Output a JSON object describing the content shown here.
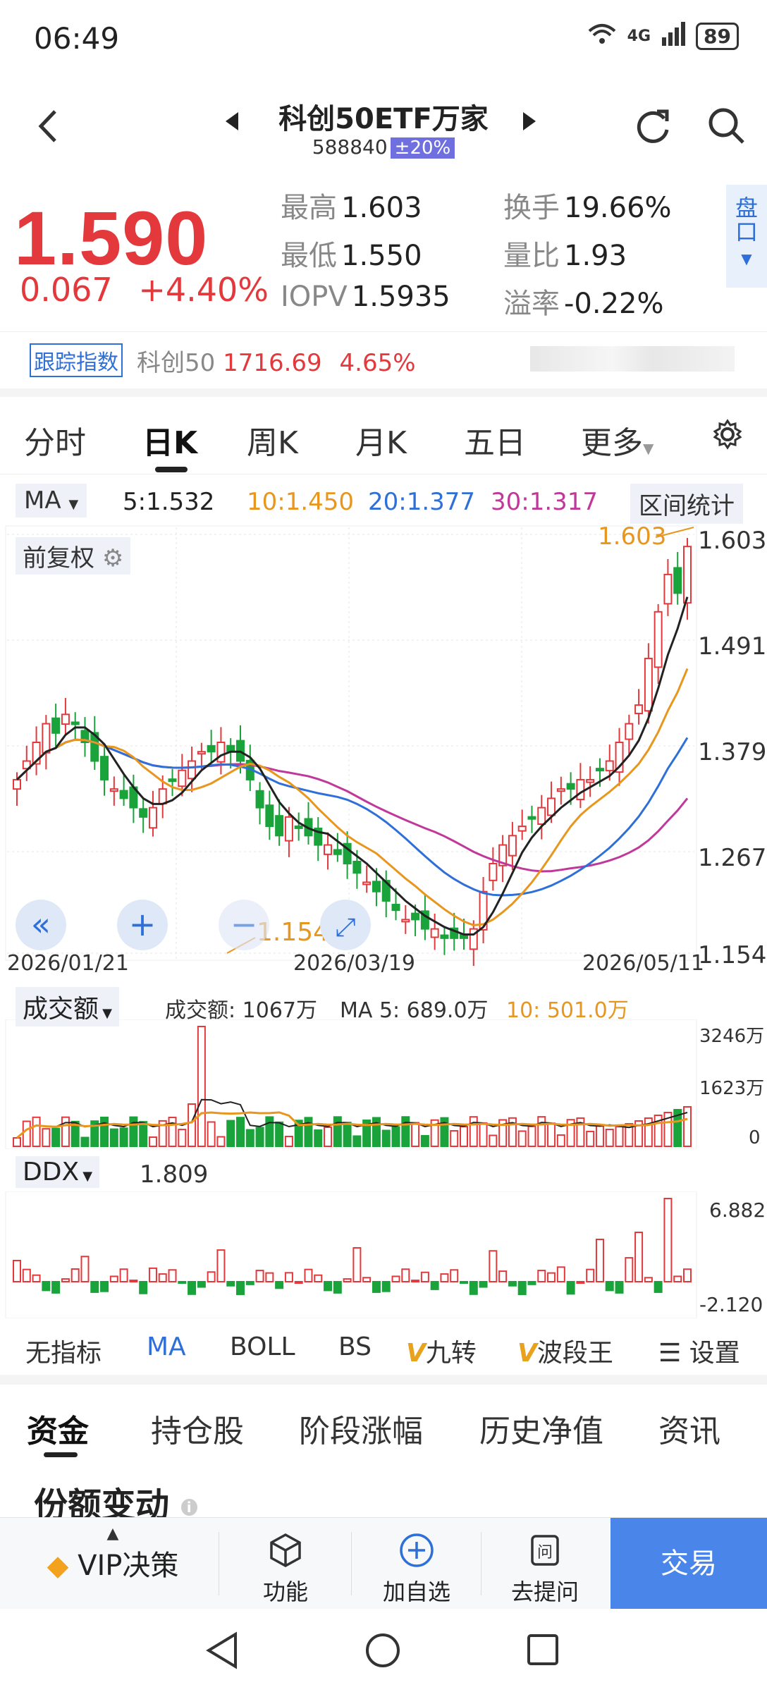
{
  "status": {
    "time": "06:49",
    "network": "4G",
    "battery": "89"
  },
  "header": {
    "title": "科创50ETF万家",
    "code": "588840",
    "limit_badge": "±20%"
  },
  "quote": {
    "price": "1.590",
    "change": "0.067",
    "change_pct": "+4.40%",
    "stats": [
      {
        "label": "最高",
        "value": "1.603"
      },
      {
        "label": "换手",
        "value": "19.66%"
      },
      {
        "label": "最低",
        "value": "1.550"
      },
      {
        "label": "量比",
        "value": "1.93"
      },
      {
        "label": "IOPV",
        "value": "1.5935"
      },
      {
        "label": "溢率",
        "value": "-0.22%"
      }
    ],
    "pankou": "盘口"
  },
  "tracking": {
    "badge": "跟踪指数",
    "index_name": "科创50",
    "index_value": "1716.69",
    "index_pct": "4.65%"
  },
  "period_tabs": [
    "分时",
    "日K",
    "周K",
    "月K",
    "五日",
    "更多"
  ],
  "ma_bar": {
    "selector": "MA",
    "values": [
      {
        "label": "5:1.532",
        "color": "#222222"
      },
      {
        "label": "10:1.450",
        "color": "#e8961e"
      },
      {
        "label": "20:1.377",
        "color": "#2f6fd8"
      },
      {
        "label": "30:1.317",
        "color": "#c0399a"
      }
    ],
    "range_stats": "区间统计"
  },
  "kline": {
    "adjust_label": "前复权",
    "y_ticks": [
      "1.603",
      "1.491",
      "1.379",
      "1.267",
      "1.154"
    ],
    "dates": [
      "2026/01/21",
      "2026/03/19",
      "2026/05/11"
    ],
    "high_marker": "1.603",
    "low_marker": "1.154"
  },
  "volume": {
    "selector": "成交额",
    "current": "成交额: 1067万",
    "ma5": "MA 5: 689.0万",
    "ma10": "10: 501.0万",
    "y_ticks": [
      "3246万",
      "1623万",
      "0"
    ]
  },
  "ddx": {
    "selector": "DDX",
    "value": "1.809",
    "y_ticks": [
      "6.882",
      "-2.120"
    ]
  },
  "indicators": [
    "无指标",
    "MA",
    "BOLL",
    "BS",
    "九转",
    "波段王",
    "设置"
  ],
  "bottom_tabs": [
    "资金",
    "持仓股",
    "阶段涨幅",
    "历史净值",
    "资讯"
  ],
  "section_title": "份额变动",
  "bottom_bar": {
    "vip": "VIP决策",
    "func": "功能",
    "add": "加自选",
    "ask": "去提问",
    "trade": "交易"
  },
  "colors": {
    "up": "#e3393c",
    "down": "#1aa33a",
    "ma5": "#222222",
    "ma10": "#e8961e",
    "ma20": "#2f6fd8",
    "ma30": "#c0399a",
    "accent": "#2f6fd8"
  },
  "chart_data": {
    "type": "candlestick",
    "y_range": [
      1.154,
      1.603
    ],
    "x_labels": [
      "2026/01/21",
      "2026/03/19",
      "2026/05/11"
    ],
    "last_close": 1.59,
    "ma": {
      "MA5": 1.532,
      "MA10": 1.45,
      "MA20": 1.377,
      "MA30": 1.317
    }
  }
}
